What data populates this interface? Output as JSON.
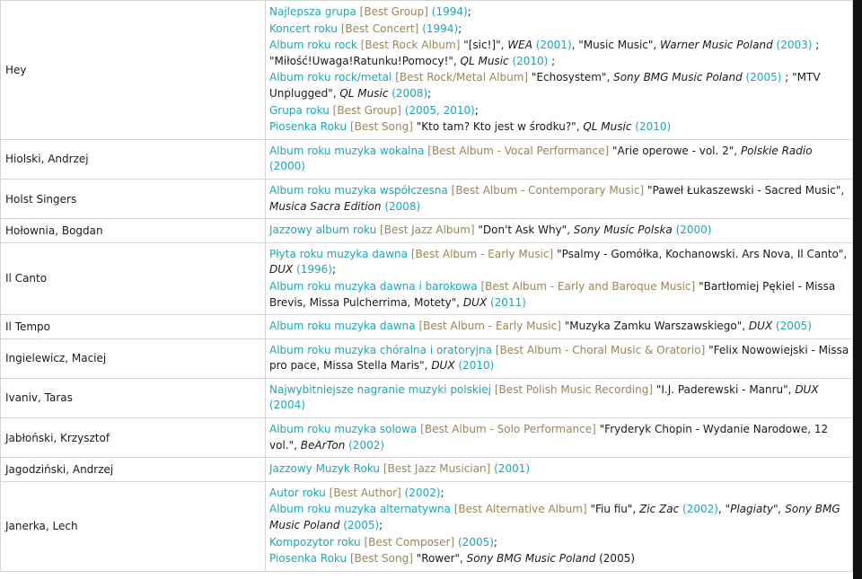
{
  "rows": [
    {
      "name": "Hey",
      "awards": [
        {
          "cat": "Najlepsza grupa",
          "en": "[Best Group]",
          "parts": [
            {
              "t": "year",
              "v": "(1994)"
            },
            {
              "t": "sep",
              "v": ";"
            }
          ]
        },
        {
          "cat": "Koncert roku",
          "en": "[Best Concert]",
          "parts": [
            {
              "t": "year",
              "v": "(1994)"
            },
            {
              "t": "sep",
              "v": ";"
            }
          ]
        },
        {
          "cat": "Album roku rock",
          "en": "[Best Rock Album]",
          "parts": [
            {
              "t": "title",
              "v": "\"[sic!]\", "
            },
            {
              "t": "label",
              "v": "WEA"
            },
            {
              "t": "year",
              "v": " (2001)"
            },
            {
              "t": "title",
              "v": ", \"Music Music\", "
            },
            {
              "t": "label",
              "v": "Warner Music Poland"
            },
            {
              "t": "year",
              "v": " (2003)"
            },
            {
              "t": "sep",
              "v": " ; \"Miłość!Uwaga!Ratunku!Pomocy!\", "
            },
            {
              "t": "label",
              "v": "QL Music"
            },
            {
              "t": "year",
              "v": " (2010)"
            },
            {
              "t": "sep",
              "v": " ;"
            }
          ]
        },
        {
          "cat": "Album roku rock/metal",
          "en": "[Best Rock/Metal Album]",
          "parts": [
            {
              "t": "title",
              "v": "\"Echosystem\", "
            },
            {
              "t": "label",
              "v": "Sony BMG Music Poland"
            },
            {
              "t": "year",
              "v": " (2005)"
            },
            {
              "t": "sep",
              "v": " ; \"MTV Unplugged\", "
            },
            {
              "t": "label",
              "v": "QL Music"
            },
            {
              "t": "year",
              "v": " (2008)"
            },
            {
              "t": "sep",
              "v": ";"
            }
          ]
        },
        {
          "cat": "Grupa roku",
          "en": "[Best Group]",
          "parts": [
            {
              "t": "year",
              "v": "(2005, 2010)"
            },
            {
              "t": "sep",
              "v": ";"
            }
          ]
        },
        {
          "cat": "Piosenka Roku",
          "en": "[Best Song]",
          "parts": [
            {
              "t": "title",
              "v": "\"Kto tam? Kto jest w środku?\", "
            },
            {
              "t": "label",
              "v": "QL Music"
            },
            {
              "t": "year",
              "v": " (2010)"
            }
          ]
        }
      ]
    },
    {
      "name": "Hiolski, Andrzej",
      "awards": [
        {
          "cat": "Album roku muzyka wokalna",
          "en": "[Best Album - Vocal Performance]",
          "parts": [
            {
              "t": "title",
              "v": "\"Arie operowe - vol. 2\", "
            },
            {
              "t": "label",
              "v": "Polskie Radio"
            },
            {
              "t": "year",
              "v": " (2000)"
            }
          ]
        }
      ]
    },
    {
      "name": "Holst Singers",
      "awards": [
        {
          "cat": "Album roku muzyka współczesna",
          "en": "[Best Album - Contemporary Music]",
          "parts": [
            {
              "t": "title",
              "v": "\"Paweł Łukaszewski - Sacred Music\", "
            },
            {
              "t": "label",
              "v": "Musica Sacra Edition"
            },
            {
              "t": "year",
              "v": " (2008)"
            }
          ]
        }
      ]
    },
    {
      "name": "Hołownia, Bogdan",
      "awards": [
        {
          "cat": "Jazzowy album roku",
          "en": "[Best Jazz Album]",
          "parts": [
            {
              "t": "title",
              "v": "\"Don't Ask Why\", "
            },
            {
              "t": "label",
              "v": "Sony Music Polska"
            },
            {
              "t": "year",
              "v": " (2000)"
            }
          ]
        }
      ]
    },
    {
      "name": "Il Canto",
      "awards": [
        {
          "cat": "Płyta roku muzyka dawna",
          "en": "[Best Album - Early Music]",
          "parts": [
            {
              "t": "title",
              "v": "\"Psalmy - Gomółka, Kochanowski. Ars Nova, Il Canto\", "
            },
            {
              "t": "label",
              "v": "DUX"
            },
            {
              "t": "year",
              "v": " (1996)"
            },
            {
              "t": "sep",
              "v": ";"
            }
          ]
        },
        {
          "cat": "Album roku muzyka dawna i barokowa",
          "en": "[Best Album - Early and Baroque Music]",
          "parts": [
            {
              "t": "title",
              "v": "\"Bartłomiej Pękiel - Missa Brevis, Missa Pulcherrima, Motety\", "
            },
            {
              "t": "label",
              "v": "DUX"
            },
            {
              "t": "year",
              "v": " (2011)"
            }
          ]
        }
      ]
    },
    {
      "name": "Il Tempo",
      "awards": [
        {
          "cat": "Album roku muzyka dawna",
          "en": "[Best Album - Early Music]",
          "parts": [
            {
              "t": "title",
              "v": "\"Muzyka Zamku Warszawskiego\", "
            },
            {
              "t": "label",
              "v": "DUX"
            },
            {
              "t": "year",
              "v": " (2005)"
            }
          ]
        }
      ]
    },
    {
      "name": "Ingielewicz, Maciej",
      "awards": [
        {
          "cat": "Album roku muzyka chóralna i oratoryjna",
          "en": "[Best Album - Choral Music & Oratorio]",
          "parts": [
            {
              "t": "title",
              "v": "\"Felix Nowowiejski - Missa pro pace, Missa Stella Maris\", "
            },
            {
              "t": "label",
              "v": "DUX"
            },
            {
              "t": "year",
              "v": " (2010)"
            }
          ]
        }
      ]
    },
    {
      "name": "Ivaniv, Taras",
      "awards": [
        {
          "cat": "Najwybitniejsze nagranie muzyki polskiej",
          "en": "[Best Polish Music Recording]",
          "parts": [
            {
              "t": "title",
              "v": "\"I.J. Paderewski - Manru\", "
            },
            {
              "t": "label",
              "v": "DUX"
            },
            {
              "t": "year",
              "v": " (2004)"
            }
          ]
        }
      ]
    },
    {
      "name": "Jabłoński, Krzysztof",
      "awards": [
        {
          "cat": "Album roku muzyka solowa",
          "en": "[Best Album - Solo Performance]",
          "parts": [
            {
              "t": "title",
              "v": "\"Fryderyk Chopin - Wydanie Narodowe, 12 vol.\", "
            },
            {
              "t": "label",
              "v": "BeArTon"
            },
            {
              "t": "year",
              "v": " (2002)"
            }
          ]
        }
      ]
    },
    {
      "name": "Jagodziński, Andrzej",
      "awards": [
        {
          "cat": "Jazzowy Muzyk Roku",
          "en": "[Best Jazz Musician]",
          "parts": [
            {
              "t": "year",
              "v": "(2001)"
            }
          ]
        }
      ]
    },
    {
      "name": "Janerka, Lech",
      "awards": [
        {
          "cat": "Autor roku",
          "en": "[Best Author]",
          "parts": [
            {
              "t": "year",
              "v": "(2002)"
            },
            {
              "t": "sep",
              "v": ";"
            }
          ]
        },
        {
          "cat": "Album roku muzyka alternatywna",
          "en": "[Best Alternative Album]",
          "parts": [
            {
              "t": "title",
              "v": "\"Fiu fiu\", "
            },
            {
              "t": "label",
              "v": "Zic Zac"
            },
            {
              "t": "year",
              "v": " (2002)"
            },
            {
              "t": "sep",
              "v": ", "
            },
            {
              "t": "label",
              "v": "\"Plagiaty\", Sony BMG Music Poland"
            },
            {
              "t": "year",
              "v": " (2005)"
            },
            {
              "t": "sep",
              "v": ";"
            }
          ]
        },
        {
          "cat": "Kompozytor roku",
          "en": "[Best Composer]",
          "parts": [
            {
              "t": "year",
              "v": "(2005)"
            },
            {
              "t": "sep",
              "v": ";"
            }
          ]
        },
        {
          "cat": "Piosenka Roku",
          "en": "[Best Song]",
          "parts": [
            {
              "t": "title",
              "v": "\"Rower\", "
            },
            {
              "t": "label",
              "v": "Sony BMG Music Poland"
            },
            {
              "t": "title",
              "v": " (2005)"
            }
          ]
        }
      ]
    }
  ]
}
